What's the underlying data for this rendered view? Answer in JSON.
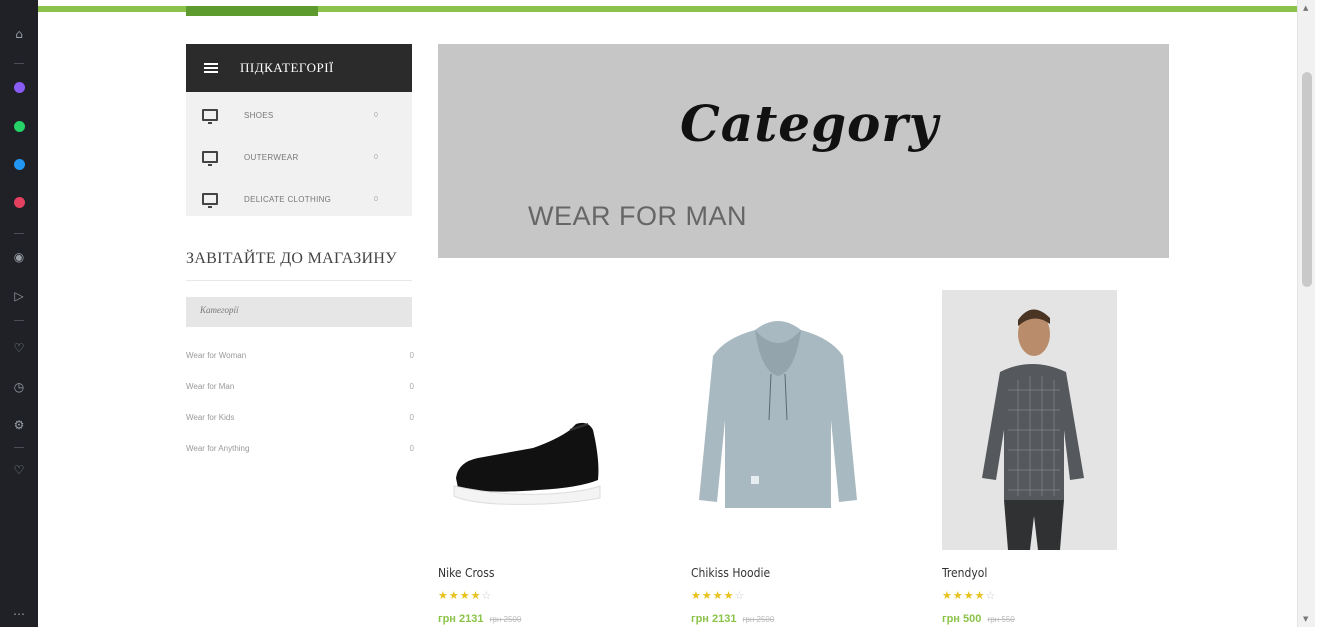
{
  "sidebar": {
    "header_title": "ПІДКАТЕГОРІЇ",
    "subcategories": [
      {
        "label": "SHOES",
        "count": "0"
      },
      {
        "label": "OUTERWEAR",
        "count": "0"
      },
      {
        "label": "DELICATE CLOTHING",
        "count": "0"
      }
    ]
  },
  "visit": {
    "title": "ЗАВІТАЙТЕ ДО МАГАЗИНУ",
    "category_label": "Категорії",
    "categories": [
      {
        "label": "Wear for Woman",
        "count": "0"
      },
      {
        "label": "Wear for Man",
        "count": "0"
      },
      {
        "label": "Wear for Kids",
        "count": "0"
      },
      {
        "label": "Wear for Anything",
        "count": "0"
      }
    ]
  },
  "hero": {
    "script_title": "Category",
    "subtitle": "WEAR FOR MAN",
    "background": "#c6c6c6"
  },
  "products": [
    {
      "name": "Nike Cross",
      "rating": 4,
      "price": "грн 2131",
      "old_price": "грн 2500"
    },
    {
      "name": "Chikiss Hoodie",
      "rating": 4,
      "price": "грн 2131",
      "old_price": "грн 2500"
    },
    {
      "name": "Trendyol",
      "rating": 4,
      "price": "грн 500",
      "old_price": "грн 550"
    }
  ],
  "colors": {
    "accent": "#8bc34a",
    "dark": "#2b2b2b",
    "star": "#e8c21b"
  }
}
